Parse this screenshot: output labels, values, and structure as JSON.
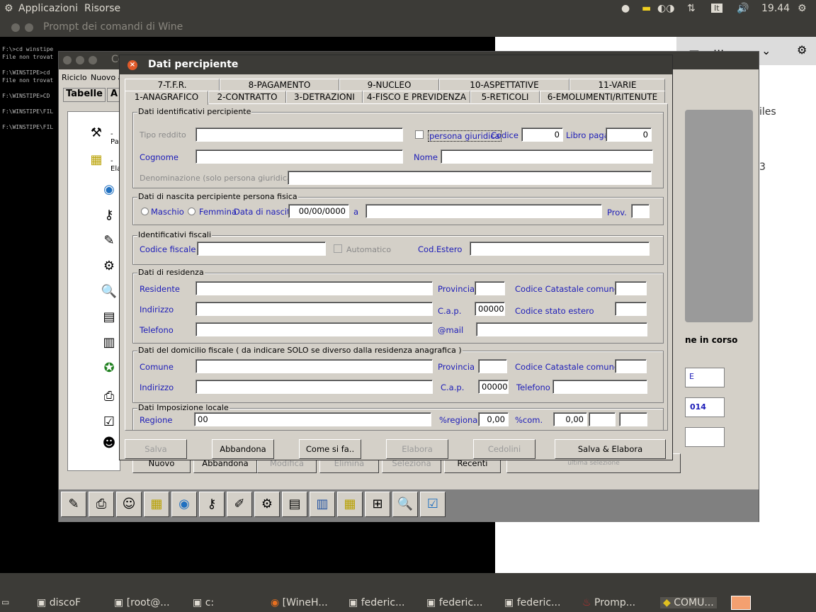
{
  "topbar": {
    "apps": "Applicazioni",
    "resources": "Risorse",
    "kb": "It",
    "time": "19.44"
  },
  "console_window": {
    "title": "Prompt dei comandi di Wine",
    "lines": "F:\\>cd winstipe\nFile non trovat\n\nF:\\WINSTIPE>cd\nFile non trovat\n\nF:\\WINSTIPE>CD\n\nF:\\WINSTIPE\\FIL\n\nF:\\WINSTIPE\\FIL"
  },
  "right_window": {
    "text1": "iles",
    "text2": "3",
    "text3": "ne in corso",
    "text4": "E",
    "text5": "014"
  },
  "bg_window": {
    "title": "Co",
    "menu1": "Riciclo",
    "menu2": "Nuovo a",
    "tab1": "Tabelle",
    "tab2": "A",
    "tree1": "- Pa",
    "tree2": "- Ela",
    "btns": [
      "Nuovo",
      "Abbandona",
      "Modifica",
      "Elimina",
      "Seleziona",
      "Recenti",
      "ultima selezione"
    ]
  },
  "dialog": {
    "title": "Dati percipiente",
    "tabs_row1": [
      "7-T.F.R.",
      "8-PAGAMENTO",
      "9-NUCLEO",
      "10-ASPETTATIVE",
      "11-VARIE"
    ],
    "tabs_row2": [
      "1-ANAGRAFICO",
      "2-CONTRATTO",
      "3-DETRAZIONI",
      "4-FISCO E PREVIDENZA",
      "5-RETICOLI",
      "6-EMOLUMENTI/RITENUTE"
    ],
    "g1": {
      "title": "Dati identificativi percipiente",
      "tipo_reddito": "Tipo reddito",
      "persona_giuridica": "persona giuridica",
      "codice": "Codice",
      "codice_val": "0",
      "libro_paga": "Libro paga",
      "libro_paga_val": "0",
      "cognome": "Cognome",
      "nome": "Nome",
      "denominazione": "Denominazione (solo persona giuridica)"
    },
    "g2": {
      "title": "Dati di nascita percipiente persona fisica",
      "maschio": "Maschio",
      "femmina": "Femmina",
      "data_nascita": "Data di nascita",
      "data_val": "00/00/0000",
      "a": "a",
      "prov": "Prov."
    },
    "g3": {
      "title": "Identificativi fiscali",
      "codice_fiscale": "Codice fiscale",
      "automatico": "Automatico",
      "cod_estero": "Cod.Estero"
    },
    "g4": {
      "title": "Dati di residenza",
      "residente": "Residente",
      "provincia": "Provincia",
      "cod_catastale": "Codice Catastale comune",
      "indirizzo": "Indirizzo",
      "cap": "C.a.p.",
      "cap_val": "00000",
      "cod_stato": "Codice stato estero",
      "telefono": "Telefono",
      "mail": "@mail"
    },
    "g5": {
      "title": "Dati del domicilio fiscale    ( da indicare SOLO se diverso dalla residenza anagrafica )",
      "comune": "Comune",
      "provincia": "Provincia",
      "cod_catastale": "Codice Catastale comune",
      "indirizzo": "Indirizzo",
      "cap": "C.a.p.",
      "cap_val": "00000",
      "telefono": "Telefono"
    },
    "g6": {
      "title": "Dati Imposizione locale",
      "regione": "Regione",
      "regione_val": "00",
      "regionale": "%regionale",
      "regionale_val": "0,00",
      "com": "%com.",
      "com_val": "0,00"
    },
    "buttons": {
      "salva": "Salva",
      "abbandona": "Abbandona",
      "come": "Come si fa..",
      "elabora": "Elabora",
      "cedolini": "Cedolini",
      "salva_elabora": "Salva & Elabora"
    }
  },
  "taskbar": [
    "discoF",
    "[root@...",
    "c:",
    "[WineH...",
    "federic...",
    "federic...",
    "federic...",
    "Promp...",
    "COMU..."
  ]
}
